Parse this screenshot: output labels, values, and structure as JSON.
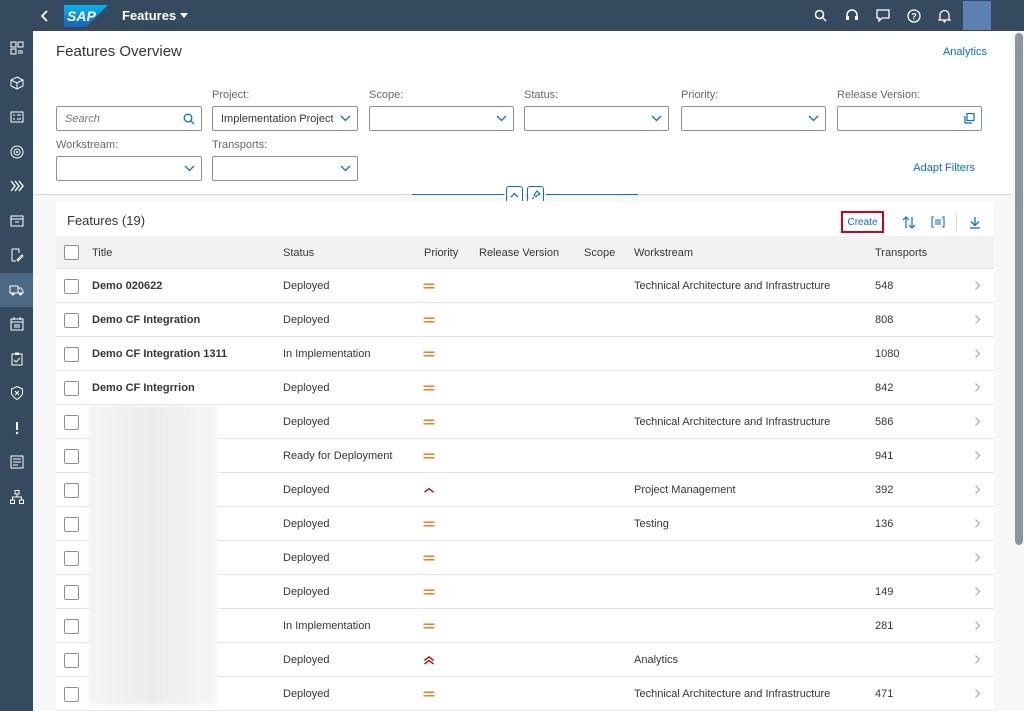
{
  "shell": {
    "title": "Features",
    "logo_text": "SAP",
    "icons": [
      "search-icon",
      "headset-icon",
      "feedback-icon",
      "help-icon",
      "notifications-icon"
    ],
    "brand_color": "#354a5f"
  },
  "sidenav": {
    "items": [
      "overview-icon",
      "cube-icon",
      "checklist-icon",
      "target-icon",
      "forward-icon",
      "document-icon",
      "edit-icon",
      "truck-icon",
      "calendar-icon",
      "clipboard-icon",
      "shield-icon",
      "alert-icon",
      "report-icon",
      "org-icon"
    ],
    "active_index": 7
  },
  "header": {
    "title": "Features Overview",
    "analytics_link": "Analytics",
    "adapt_filters": "Adapt Filters"
  },
  "filters": {
    "search_placeholder": "Search",
    "project_label": "Project:",
    "project_value": "Implementation Project",
    "scope_label": "Scope:",
    "scope_value": "",
    "status_label": "Status:",
    "status_value": "",
    "priority_label": "Priority:",
    "priority_value": "",
    "release_label": "Release Version:",
    "release_value": "",
    "workstream_label": "Workstream:",
    "workstream_value": "",
    "transports_label": "Transports:",
    "transports_value": ""
  },
  "table": {
    "title": "Features (19)",
    "create_label": "Create",
    "columns": [
      "Title",
      "Status",
      "Priority",
      "Release Version",
      "Scope",
      "Workstream",
      "Transports"
    ],
    "rows": [
      {
        "title": "Demo 020622",
        "status": "Deployed",
        "priority": "medium",
        "workstream": "Technical Architecture and Infrastructure",
        "transports": "548"
      },
      {
        "title": "Demo CF Integration",
        "status": "Deployed",
        "priority": "medium",
        "workstream": "",
        "transports": "808"
      },
      {
        "title": "Demo CF Integration 1311",
        "status": "In Implementation",
        "priority": "medium",
        "workstream": "",
        "transports": "1080"
      },
      {
        "title": "Demo CF Integrrion",
        "status": "Deployed",
        "priority": "medium",
        "workstream": "",
        "transports": "842"
      },
      {
        "title": "",
        "status": "Deployed",
        "priority": "medium",
        "workstream": "Technical Architecture and Infrastructure",
        "transports": "586"
      },
      {
        "title": "",
        "status": "Ready for Deployment",
        "priority": "medium",
        "workstream": "",
        "transports": "941"
      },
      {
        "title": "",
        "status": "Deployed",
        "priority": "high",
        "workstream": "Project Management",
        "transports": "392"
      },
      {
        "title": "",
        "status": "Deployed",
        "priority": "medium",
        "workstream": "Testing",
        "transports": "136"
      },
      {
        "title": "",
        "status": "Deployed",
        "priority": "medium",
        "workstream": "",
        "transports": ""
      },
      {
        "title": "",
        "status": "Deployed",
        "priority": "medium",
        "workstream": "",
        "transports": "149"
      },
      {
        "title": "",
        "status": "In Implementation",
        "priority": "medium",
        "workstream": "",
        "transports": "281"
      },
      {
        "title": "",
        "status": "Deployed",
        "priority": "very-high",
        "workstream": "Analytics",
        "transports": ""
      },
      {
        "title": "",
        "status": "Deployed",
        "priority": "medium",
        "workstream": "Technical Architecture and Infrastructure",
        "transports": "471"
      }
    ],
    "priority_colors": {
      "medium": "#e9730c",
      "high": "#bb0000",
      "very-high": "#bb0000"
    }
  }
}
